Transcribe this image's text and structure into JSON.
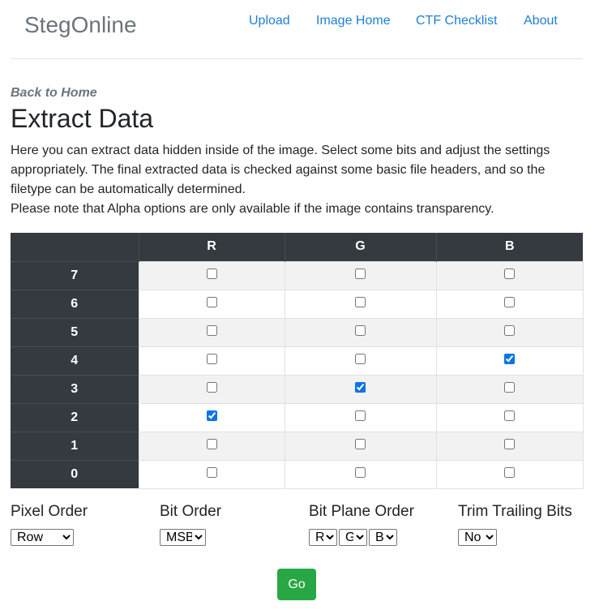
{
  "brand": "StegOnline",
  "nav": [
    "Upload",
    "Image Home",
    "CTF Checklist",
    "About"
  ],
  "back_link": "Back to Home",
  "title": "Extract Data",
  "description": [
    "Here you can extract data hidden inside of the image. Select some bits and adjust the settings appropriately. The final extracted data is checked against some basic file headers, and so the filetype can be automatically determined.",
    "Please note that Alpha options are only available if the image contains transparency."
  ],
  "table": {
    "columns": [
      "",
      "R",
      "G",
      "B"
    ],
    "rows": [
      {
        "bit": "7",
        "R": false,
        "G": false,
        "B": false
      },
      {
        "bit": "6",
        "R": false,
        "G": false,
        "B": false
      },
      {
        "bit": "5",
        "R": false,
        "G": false,
        "B": false
      },
      {
        "bit": "4",
        "R": false,
        "G": false,
        "B": true
      },
      {
        "bit": "3",
        "R": false,
        "G": true,
        "B": false
      },
      {
        "bit": "2",
        "R": true,
        "G": false,
        "B": false
      },
      {
        "bit": "1",
        "R": false,
        "G": false,
        "B": false
      },
      {
        "bit": "0",
        "R": false,
        "G": false,
        "B": false
      }
    ]
  },
  "options": {
    "pixel_order": {
      "label": "Pixel Order",
      "value": "Row"
    },
    "bit_order": {
      "label": "Bit Order",
      "value": "MSB"
    },
    "bit_plane_order": {
      "label": "Bit Plane Order",
      "values": [
        "R",
        "G",
        "B"
      ]
    },
    "trim_trailing_bits": {
      "label": "Trim Trailing Bits",
      "value": "No"
    }
  },
  "go_button": "Go"
}
